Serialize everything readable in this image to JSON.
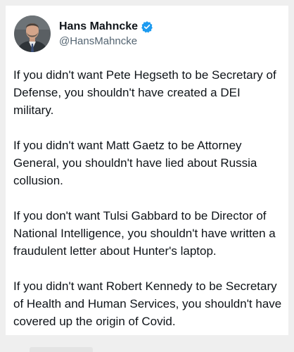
{
  "author": {
    "display_name": "Hans Mahncke",
    "handle": "@HansMahncke",
    "verified": true,
    "avatar_icon": "profile-photo",
    "verified_icon": "verified-badge-icon"
  },
  "tweet": {
    "paragraphs": [
      "If you didn't want Pete Hegseth to be Secretary of Defense, you shouldn't have created a DEI military.",
      "If you didn't want Matt Gaetz to be Attorney General, you shouldn't have lied about Russia collusion.",
      "If you don't want Tulsi Gabbard to be Director of National Intelligence, you shouldn't have written a fraudulent letter about Hunter's laptop.",
      "If you didn't want Robert Kennedy to be Secretary of Health and Human Services, you shouldn't have covered up the origin of Covid."
    ]
  },
  "colors": {
    "background": "#efefef",
    "card": "#ffffff",
    "text": "#0f1419",
    "secondary_text": "#536471",
    "verified_blue": "#1d9bf0"
  }
}
